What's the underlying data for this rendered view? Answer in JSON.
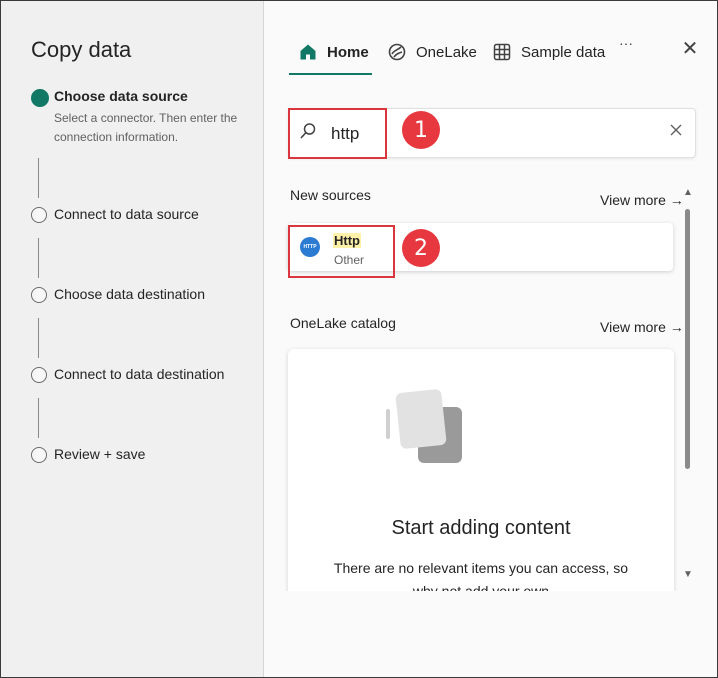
{
  "wizard": {
    "title": "Copy data",
    "steps": [
      {
        "label": "Choose data source",
        "description": "Select a connector. Then enter the connection information.",
        "active": true
      },
      {
        "label": "Connect to data source"
      },
      {
        "label": "Choose data destination"
      },
      {
        "label": "Connect to data destination"
      },
      {
        "label": "Review + save"
      }
    ]
  },
  "tabs": [
    {
      "label": "Home",
      "icon": "home-icon"
    },
    {
      "label": "OneLake",
      "icon": "onelake-icon"
    },
    {
      "label": "Sample data",
      "icon": "sample-data-icon"
    }
  ],
  "more_label": "···",
  "close_label": "✕",
  "search": {
    "value": "http"
  },
  "new_sources": {
    "label": "New sources",
    "view_more": "View more →",
    "items": [
      {
        "name": "Http",
        "category": "Other",
        "logo_text": "HTTP"
      }
    ]
  },
  "onelake_catalog": {
    "label": "OneLake catalog",
    "view_more": "View more →",
    "empty_title": "Start adding content",
    "empty_description": "There are no relevant items you can access, so why not add your own"
  },
  "callouts": [
    "1",
    "2"
  ],
  "colors": {
    "accent": "#117865",
    "callout": "#e8383f",
    "highlight": "#fff2a8"
  }
}
